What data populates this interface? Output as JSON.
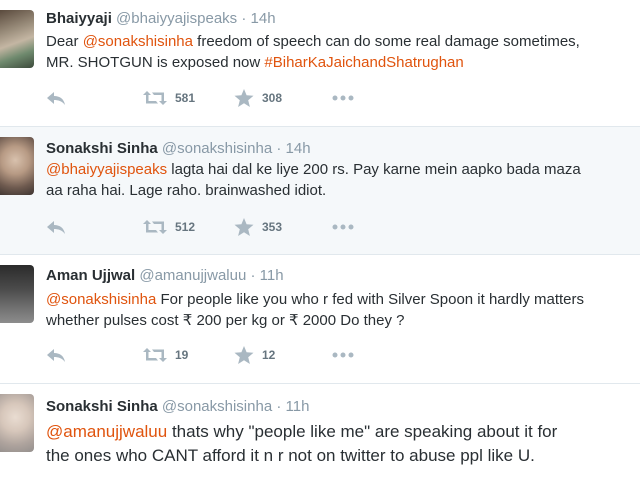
{
  "colors": {
    "accent": "#e0540e",
    "muted": "#8899a6",
    "icon": "#aab8c2",
    "text": "#292f33"
  },
  "tweets": [
    {
      "name": "Bhaiyyaji",
      "handle": "@bhaiyyajispeaks",
      "dot": "·",
      "time": "14h",
      "line1": {
        "pre": "Dear ",
        "mention": "@sonakshisinha",
        "post": " freedom of speech can do some real damage sometimes,"
      },
      "line2": {
        "pre": "MR. SHOTGUN is exposed now ",
        "hashtag": "#BiharKaJaichandShatrughan"
      },
      "retweets": "581",
      "favorites": "308"
    },
    {
      "name": "Sonakshi Sinha",
      "handle": "@sonakshisinha",
      "dot": "·",
      "time": "14h",
      "line1": {
        "mention": "@bhaiyyajispeaks",
        "post": " lagta hai dal ke liye 200 rs. Pay karne mein aapko bada maza"
      },
      "line2": {
        "pre": "aa raha hai. Lage raho. brainwashed idiot."
      },
      "retweets": "512",
      "favorites": "353"
    },
    {
      "name": "Aman Ujjwal",
      "handle": "@amanujjwaluu",
      "dot": "·",
      "time": "11h",
      "line1": {
        "mention": "@sonakshisinha",
        "post": " For people like you who r fed with Silver Spoon it hardly matters"
      },
      "line2": {
        "pre": "whether pulses cost ₹ 200 per kg or ₹ 2000 Do they ?"
      },
      "retweets": "19",
      "favorites": "12"
    },
    {
      "name": "Sonakshi Sinha",
      "handle": "@sonakshisinha",
      "dot": "·",
      "time": "11h",
      "line1": {
        "mention": "@amanujjwaluu",
        "post": " thats why \"people like me\" are speaking about it for"
      },
      "line2": {
        "pre": "the ones who CANT afford it n r not on twitter to abuse ppl like U."
      }
    }
  ]
}
